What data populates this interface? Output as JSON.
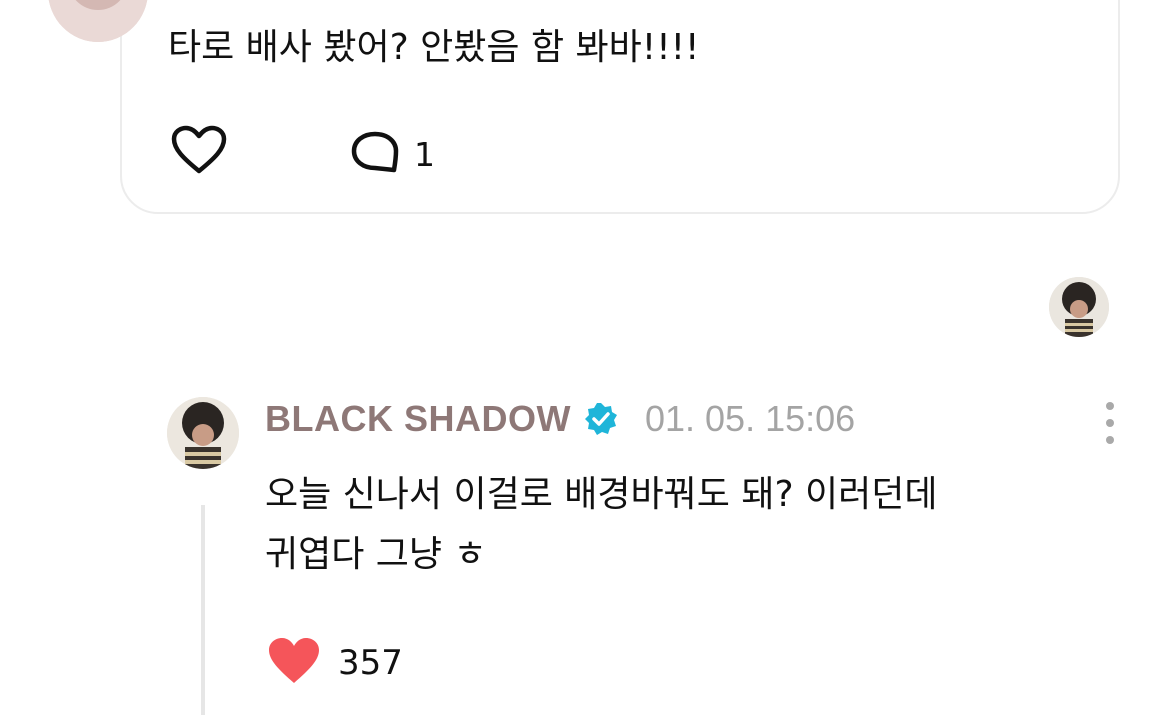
{
  "top_post": {
    "text": "타로 배사 봤어? 안봤음 함 봐바!!!!",
    "like_icon": "heart-outline-icon",
    "comment_icon": "speech-bubble-icon",
    "comment_count": "1"
  },
  "reply": {
    "username": "BLACK SHADOW",
    "verified_icon": "verified-badge-icon",
    "timestamp": "01. 05. 15:06",
    "text_line1": "오늘 신나서 이걸로 배경바꿔도 돼? 이러던데",
    "text_line2": "귀엽다 그냥 ㅎ",
    "like_icon": "heart-filled-icon",
    "like_count": "357",
    "more_icon": "more-vertical-icon"
  },
  "colors": {
    "username": "#8e7877",
    "timestamp": "#a4a4a4",
    "verified": "#1fb5d9",
    "heart_filled": "#f5555a",
    "card_border": "#ececec"
  }
}
